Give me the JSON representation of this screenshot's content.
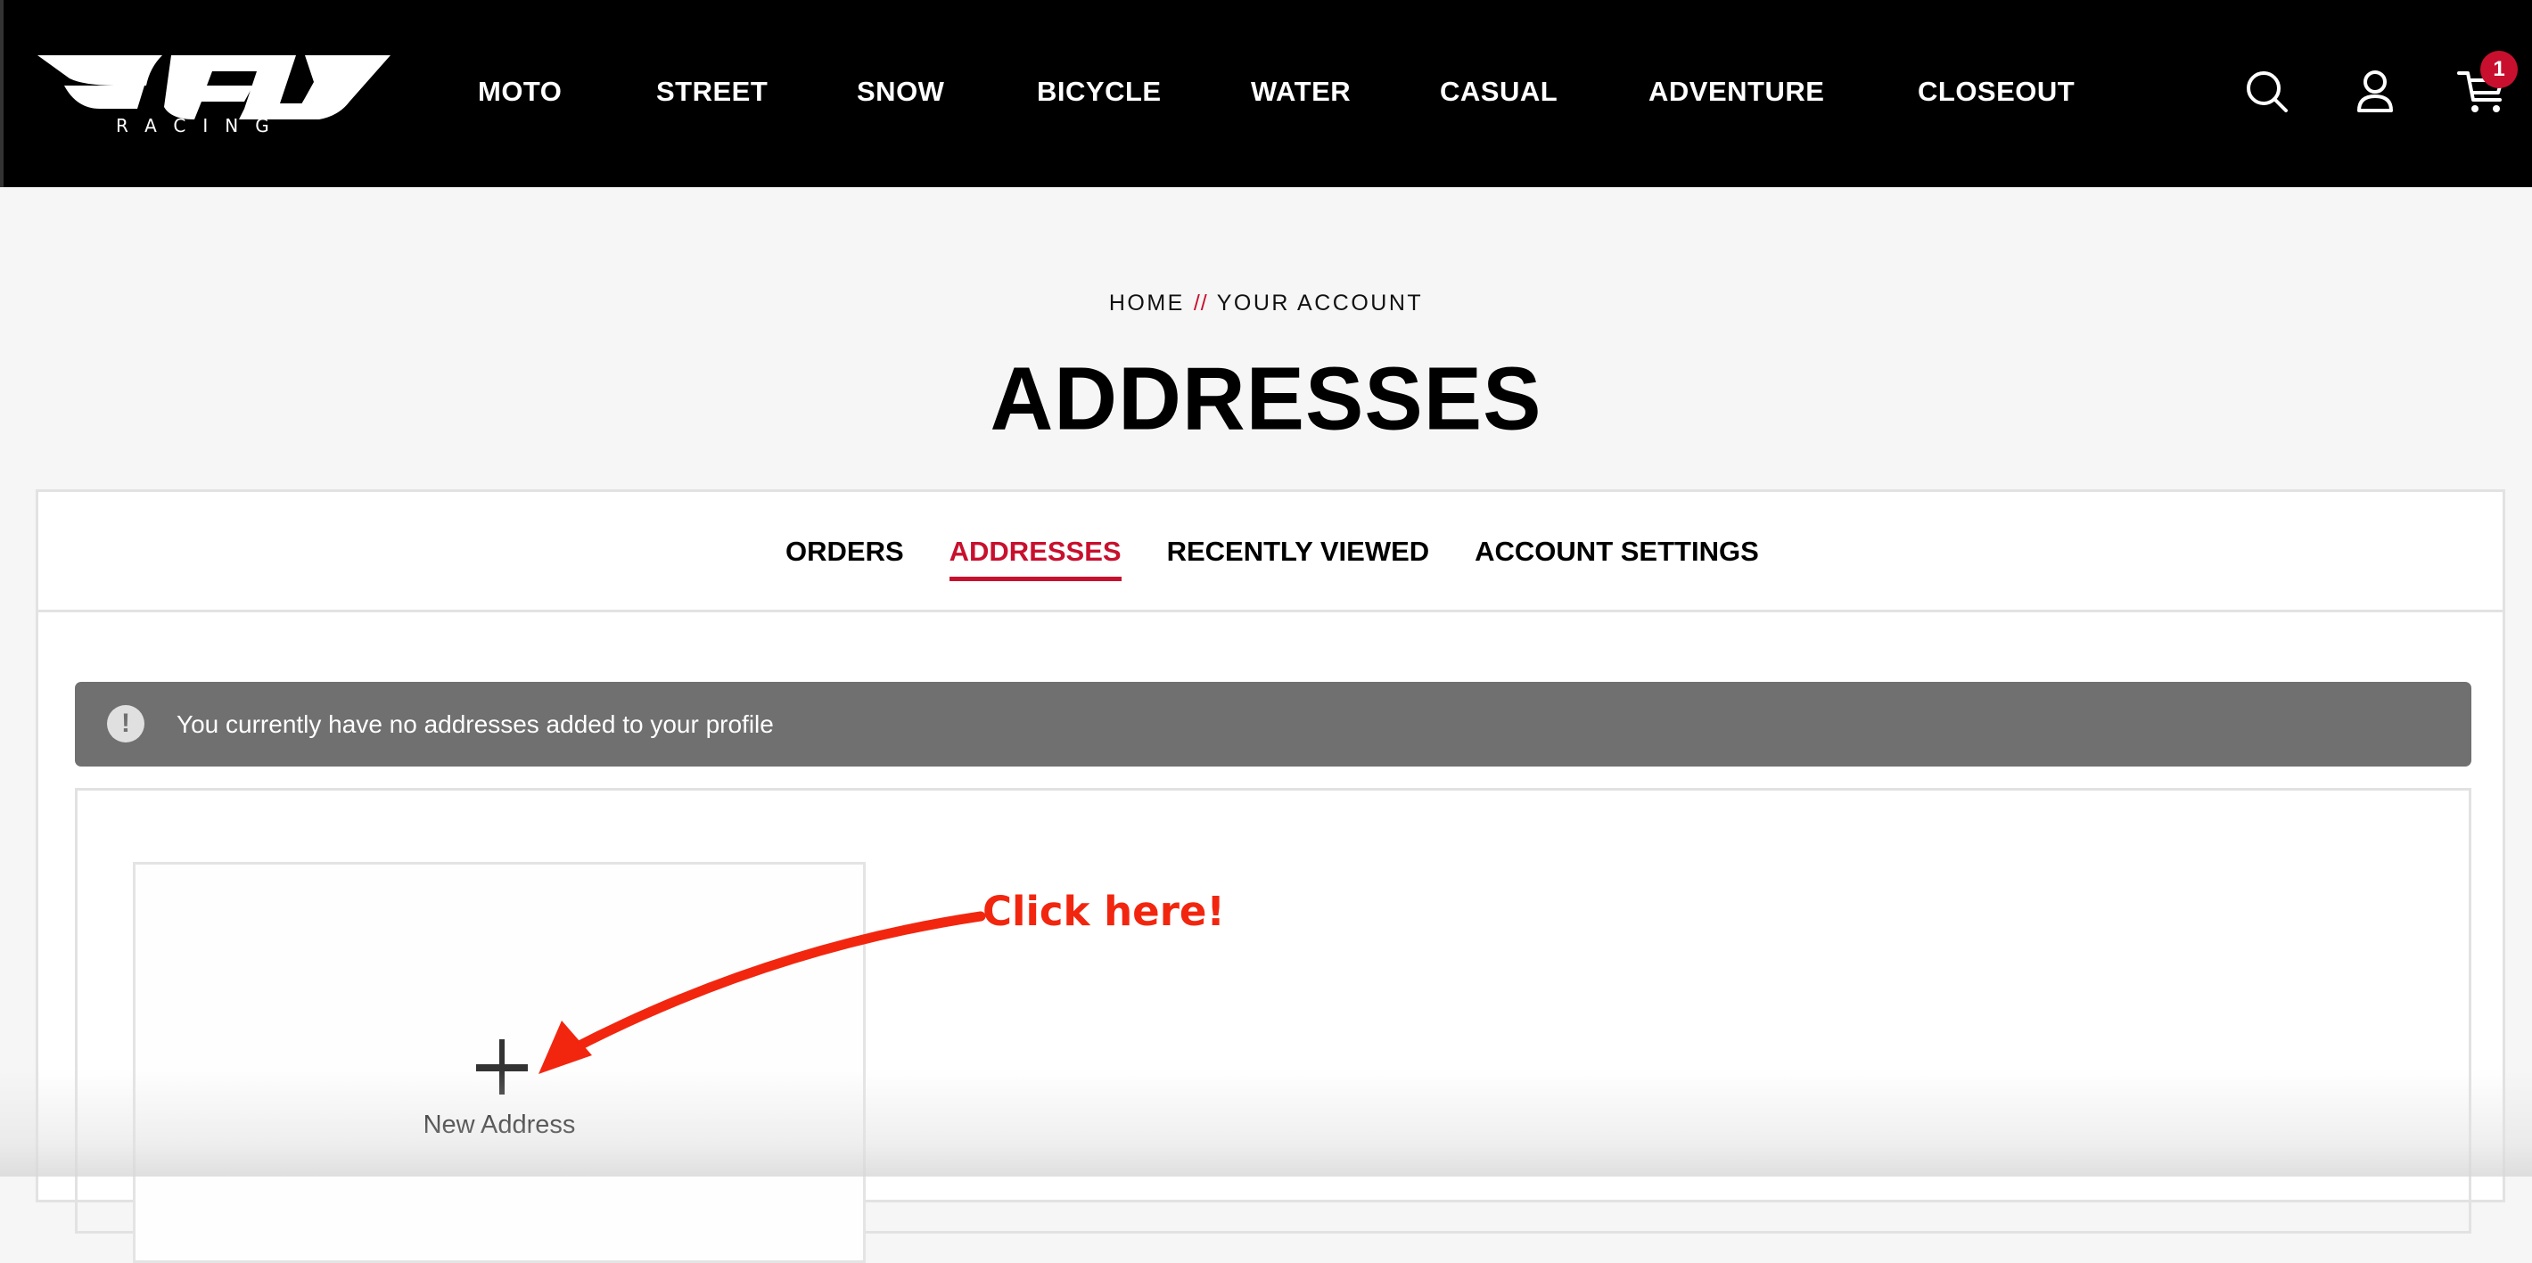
{
  "header": {
    "logo": {
      "name": "FLY",
      "sub": "RACING",
      "mark": "®"
    },
    "nav": [
      "MOTO",
      "STREET",
      "SNOW",
      "BICYCLE",
      "WATER",
      "CASUAL",
      "ADVENTURE",
      "CLOSEOUT"
    ],
    "icons": [
      "search-icon",
      "account-icon",
      "cart-icon"
    ],
    "cart_count": "1"
  },
  "breadcrumb": {
    "home": "HOME",
    "separator": "//",
    "current": "YOUR ACCOUNT"
  },
  "page_title": "ADDRESSES",
  "tabs": [
    {
      "label": "ORDERS",
      "active": false
    },
    {
      "label": "ADDRESSES",
      "active": true
    },
    {
      "label": "RECENTLY VIEWED",
      "active": false
    },
    {
      "label": "ACCOUNT SETTINGS",
      "active": false
    }
  ],
  "notice": {
    "icon": "!",
    "text": "You currently have no addresses added to your profile"
  },
  "new_address": {
    "icon": "plus-icon",
    "label": "New Address"
  },
  "annotation": {
    "text": "Click here!"
  },
  "colors": {
    "accent": "#c8102e",
    "annotation": "#f2260f",
    "banner": "#707070",
    "header": "#000000"
  }
}
